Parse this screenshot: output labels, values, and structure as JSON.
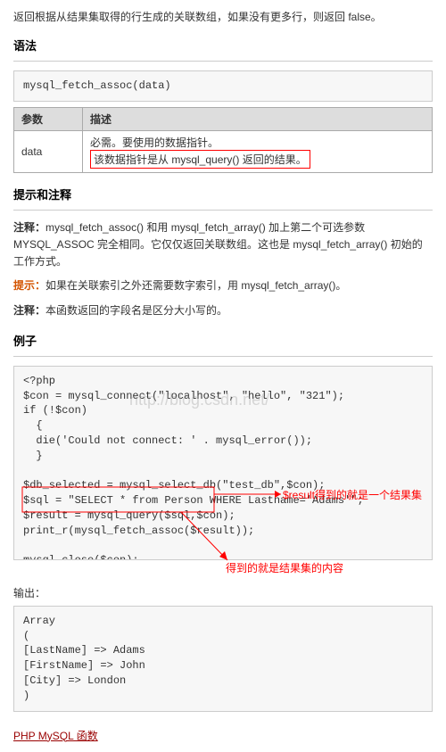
{
  "intro": "返回根据从结果集取得的行生成的关联数组，如果没有更多行，则返回 false。",
  "sections": {
    "syntax": "语法",
    "notes": "提示和注释",
    "example": "例子"
  },
  "syntax_code": "mysql_fetch_assoc(data)",
  "param_table": {
    "h1": "参数",
    "h2": "描述",
    "r1c1": "data",
    "r1c2a": "必需。要使用的数据指针。",
    "r1c2b": "该数据指针是从 mysql_query() 返回的结果。"
  },
  "notes_lines": {
    "n1_label": "注释：",
    "n1_text": "mysql_fetch_assoc() 和用 mysql_fetch_array() 加上第二个可选参数 MYSQL_ASSOC 完全相同。它仅仅返回关联数组。这也是 mysql_fetch_array() 初始的工作方式。",
    "n2_label": "提示：",
    "n2_text": "如果在关联索引之外还需要数字索引，用 mysql_fetch_array()。",
    "n3_label": "注释：",
    "n3_text": "本函数返回的字段名是区分大小写的。"
  },
  "example_code": "<?php\n$con = mysql_connect(\"localhost\", \"hello\", \"321\");\nif (!$con)\n  {\n  die('Could not connect: ' . mysql_error());\n  }\n\n$db_selected = mysql_select_db(\"test_db\",$con);\n$sql = \"SELECT * from Person WHERE Lastname='Adams'\";\n$result = mysql_query($sql,$con);\nprint_r(mysql_fetch_assoc($result));\n\nmysql_close($con);\n?>",
  "watermark": "http://blog.csdn.net/",
  "annotations": {
    "a1": "$result得到的就是一个结果集",
    "a2": "得到的就是结果集的内容"
  },
  "output_label": "输出：",
  "output_code": "Array\n(\n[LastName] => Adams\n[FirstName] => John\n[City] => London\n)",
  "footer_link": "PHP MySQL 函数"
}
